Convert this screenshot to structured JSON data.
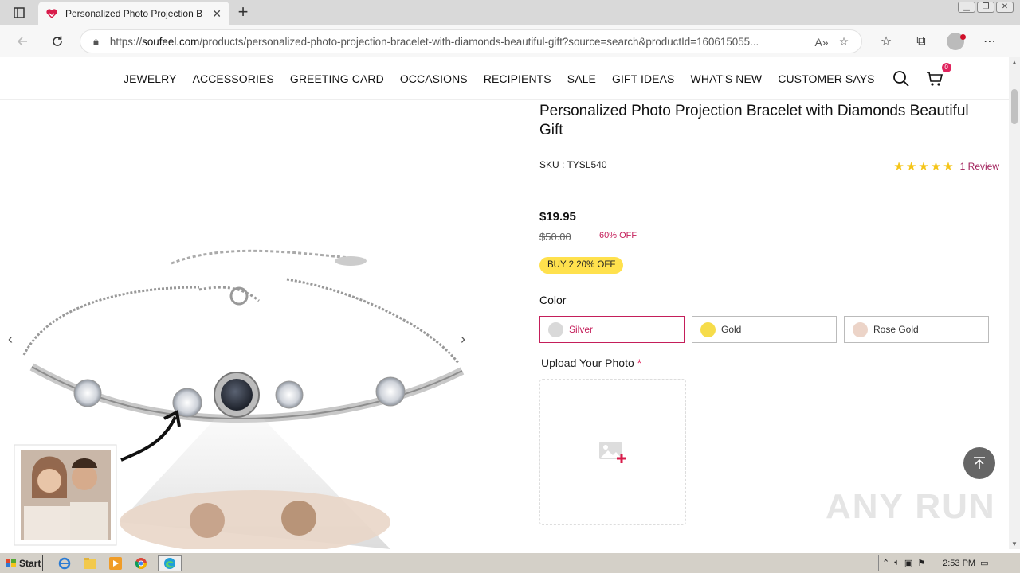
{
  "browser": {
    "tab_title": "Personalized Photo Projection Br",
    "url_prefix": "https://",
    "url_host": "soufeel.com",
    "url_rest": "/products/personalized-photo-projection-bracelet-with-diamonds-beautiful-gift?source=search&productId=160615055..."
  },
  "nav": {
    "items": [
      "JEWELRY",
      "ACCESSORIES",
      "GREETING CARD",
      "OCCASIONS",
      "RECIPIENTS",
      "SALE",
      "GIFT IDEAS",
      "WHAT'S NEW",
      "CUSTOMER SAYS"
    ],
    "cart_count": "0"
  },
  "product": {
    "title": "Personalized Photo Projection Bracelet with Diamonds Beautiful Gift",
    "sku": "SKU : TYSL540",
    "rating_stars": 5,
    "review_link": "1 Review",
    "price": "$19.95",
    "old_price": "$50.00",
    "discount": "60% OFF",
    "promo": "BUY 2 20% OFF",
    "color_label": "Color",
    "colors": [
      {
        "name": "Silver",
        "swatch": "#d9d9d9",
        "selected": true
      },
      {
        "name": "Gold",
        "swatch": "#f6dc4a",
        "selected": false
      },
      {
        "name": "Rose Gold",
        "swatch": "#ecd4c8",
        "selected": false
      }
    ],
    "upload_label": "Upload Your Photo",
    "upload_required": "*"
  },
  "watermark": "ANY RUN",
  "taskbar": {
    "start_label": "Start",
    "clock": "2:53 PM"
  },
  "colors": {
    "accent": "#c41e5a",
    "promo_bg": "#ffe14d",
    "star": "#f5c518"
  }
}
